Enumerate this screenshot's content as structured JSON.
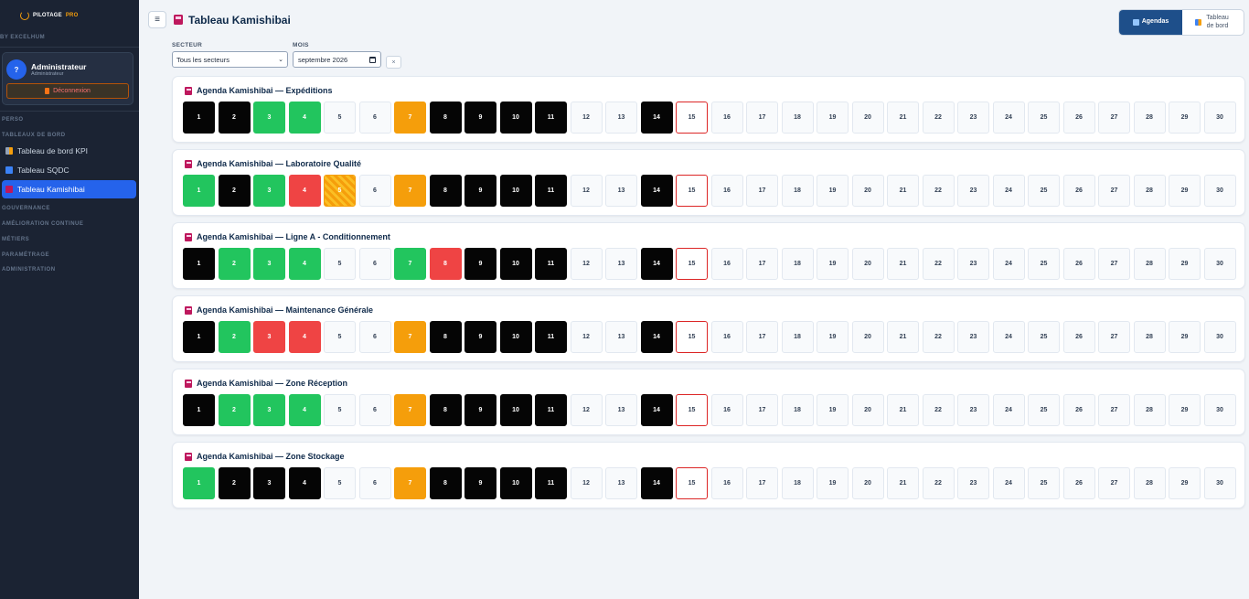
{
  "brand": {
    "name": "PILOTAGE",
    "suffix": "PRO",
    "by": "BY EXCELHUM"
  },
  "user": {
    "initial": "?",
    "name": "Administrateur",
    "role": "Administrateur",
    "logout_label": "Déconnexion"
  },
  "nav": {
    "sections": {
      "perso": "PERSO",
      "tableaux": "TABLEAUX DE BORD",
      "gouvernance": "GOUVERNANCE",
      "amelioration": "AMÉLIORATION CONTINUE",
      "metiers": "MÉTIERS",
      "parametrage": "PARAMÉTRAGE",
      "administration": "ADMINISTRATION"
    },
    "items": [
      "Tableau de bord KPI",
      "Tableau SQDC",
      "Tableau Kamishibai"
    ]
  },
  "header": {
    "title": "Tableau Kamishibai",
    "view_agendas": "Agendas",
    "view_dashboard": "Tableau de bord"
  },
  "filters": {
    "secteur_label": "SECTEUR",
    "secteur_value": "Tous les secteurs",
    "mois_label": "MOIS",
    "mois_value": "septembre 2026",
    "clear": "×"
  },
  "colors": {
    "black": "#050505",
    "green": "#22c55e",
    "orange": "#f59e0b",
    "red": "#ef4444",
    "accent": "#2563eb"
  },
  "status_legend": {
    "b": "black",
    "g": "green",
    "o": "orange",
    "r": "red",
    "h": "orange-hatched",
    "t": "today-outline",
    "e": "empty"
  },
  "days": [
    "1",
    "2",
    "3",
    "4",
    "5",
    "6",
    "7",
    "8",
    "9",
    "10",
    "11",
    "12",
    "13",
    "14",
    "15",
    "16",
    "17",
    "18",
    "19",
    "20",
    "21",
    "22",
    "23",
    "24",
    "25",
    "26",
    "27",
    "28",
    "29",
    "30"
  ],
  "agendas": [
    {
      "title": "Agenda Kamishibai — Expéditions",
      "status": [
        "b",
        "b",
        "g",
        "g",
        "e",
        "e",
        "o",
        "b",
        "b",
        "b",
        "b",
        "e",
        "e",
        "b",
        "t",
        "e",
        "e",
        "e",
        "e",
        "e",
        "e",
        "e",
        "e",
        "e",
        "e",
        "e",
        "e",
        "e",
        "e",
        "e"
      ]
    },
    {
      "title": "Agenda Kamishibai — Laboratoire Qualité",
      "status": [
        "g",
        "b",
        "g",
        "r",
        "h",
        "e",
        "o",
        "b",
        "b",
        "b",
        "b",
        "e",
        "e",
        "b",
        "t",
        "e",
        "e",
        "e",
        "e",
        "e",
        "e",
        "e",
        "e",
        "e",
        "e",
        "e",
        "e",
        "e",
        "e",
        "e"
      ]
    },
    {
      "title": "Agenda Kamishibai — Ligne A - Conditionnement",
      "status": [
        "b",
        "g",
        "g",
        "g",
        "e",
        "e",
        "g",
        "r",
        "b",
        "b",
        "b",
        "e",
        "e",
        "b",
        "t",
        "e",
        "e",
        "e",
        "e",
        "e",
        "e",
        "e",
        "e",
        "e",
        "e",
        "e",
        "e",
        "e",
        "e",
        "e"
      ]
    },
    {
      "title": "Agenda Kamishibai — Maintenance Générale",
      "status": [
        "b",
        "g",
        "r",
        "r",
        "e",
        "e",
        "o",
        "b",
        "b",
        "b",
        "b",
        "e",
        "e",
        "b",
        "t",
        "e",
        "e",
        "e",
        "e",
        "e",
        "e",
        "e",
        "e",
        "e",
        "e",
        "e",
        "e",
        "e",
        "e",
        "e"
      ]
    },
    {
      "title": "Agenda Kamishibai — Zone Réception",
      "status": [
        "b",
        "g",
        "g",
        "g",
        "e",
        "e",
        "o",
        "b",
        "b",
        "b",
        "b",
        "e",
        "e",
        "b",
        "t",
        "e",
        "e",
        "e",
        "e",
        "e",
        "e",
        "e",
        "e",
        "e",
        "e",
        "e",
        "e",
        "e",
        "e",
        "e"
      ]
    },
    {
      "title": "Agenda Kamishibai — Zone Stockage",
      "status": [
        "g",
        "b",
        "b",
        "b",
        "e",
        "e",
        "o",
        "b",
        "b",
        "b",
        "b",
        "e",
        "e",
        "b",
        "t",
        "e",
        "e",
        "e",
        "e",
        "e",
        "e",
        "e",
        "e",
        "e",
        "e",
        "e",
        "e",
        "e",
        "e",
        "e"
      ]
    }
  ]
}
